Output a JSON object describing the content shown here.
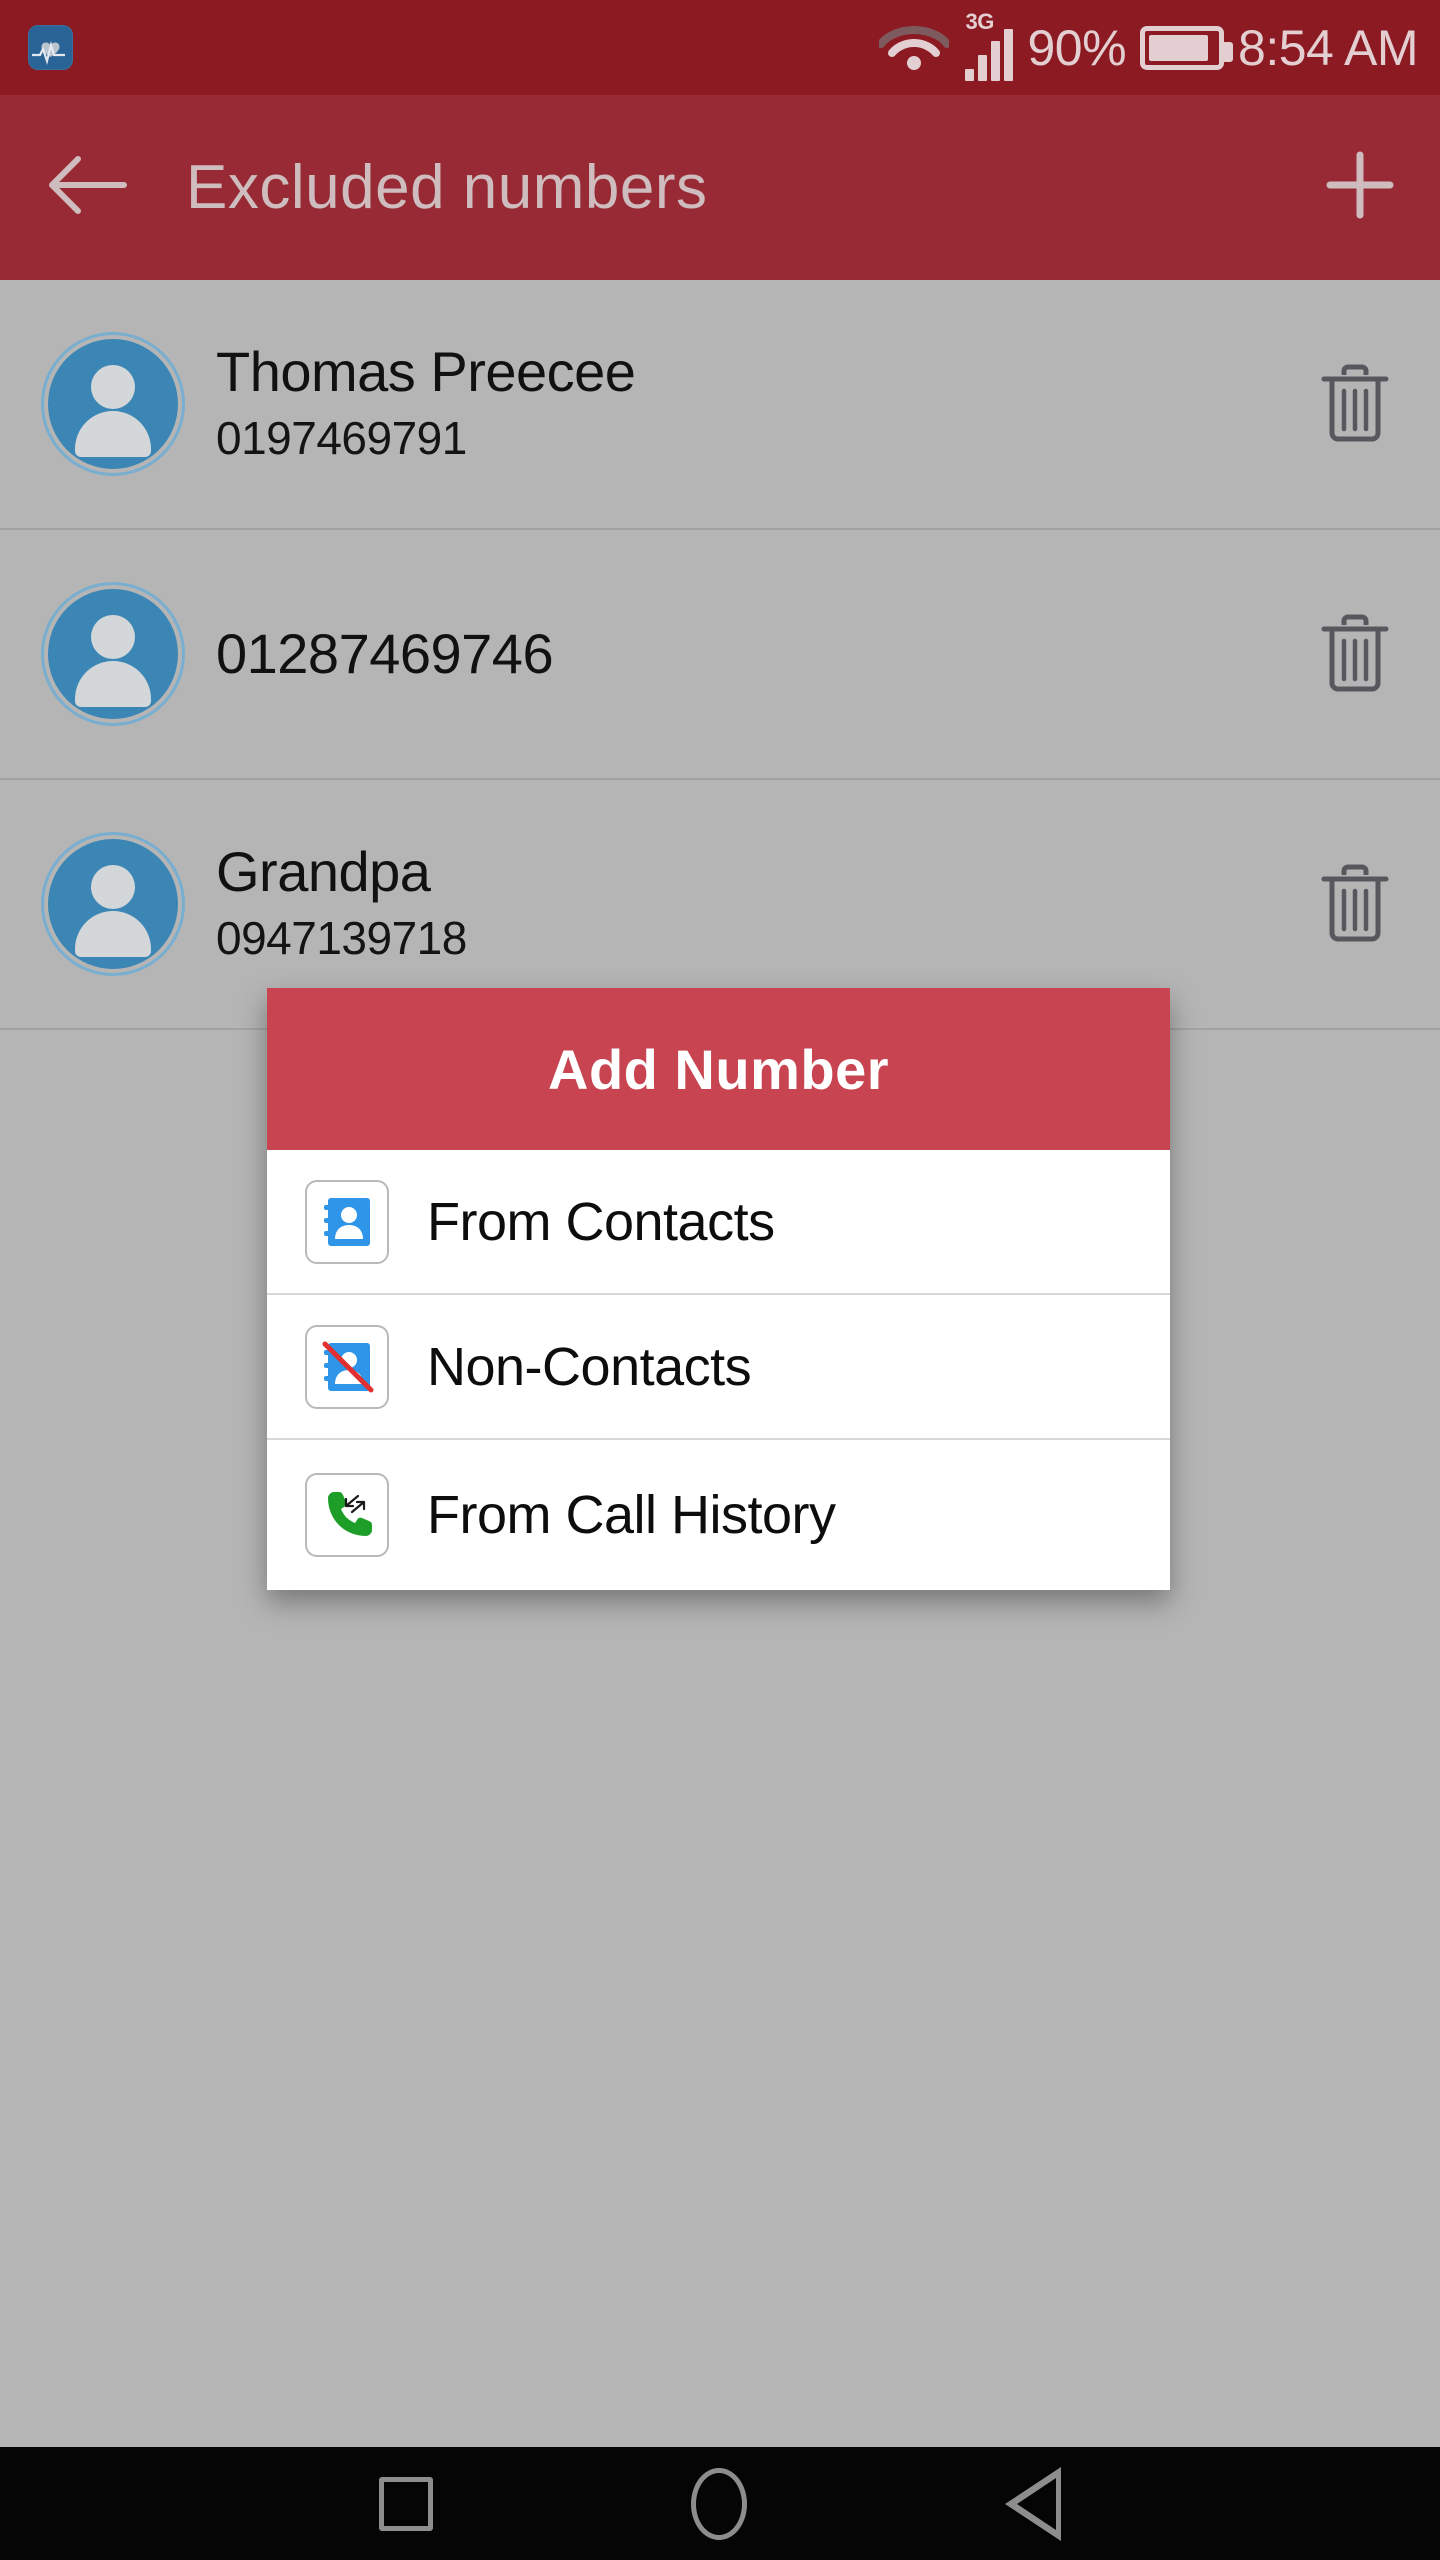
{
  "status_bar": {
    "app_icon": "heart-rate-app-icon",
    "wifi_icon": "wifi-icon",
    "network_label": "3G",
    "signal_icon": "signal-bars-icon",
    "battery_percent": "90%",
    "battery_icon": "battery-icon",
    "battery_level": 90,
    "time": "8:54 AM"
  },
  "app_bar": {
    "back_icon": "back-arrow-icon",
    "title": "Excluded numbers",
    "add_icon": "plus-icon"
  },
  "list": {
    "rows": [
      {
        "avatar_icon": "contact-avatar-icon",
        "name": "Thomas Preecee",
        "number": "0197469791",
        "delete_icon": "trash-icon"
      },
      {
        "avatar_icon": "contact-avatar-icon",
        "name": "",
        "number": "01287469746",
        "delete_icon": "trash-icon"
      },
      {
        "avatar_icon": "contact-avatar-icon",
        "name": "Grandpa",
        "number": "0947139718",
        "delete_icon": "trash-icon"
      }
    ]
  },
  "dialog": {
    "title": "Add Number",
    "header_color": "#c74450",
    "items": [
      {
        "icon": "contacts-book-icon",
        "label": "From Contacts"
      },
      {
        "icon": "contacts-book-blocked-icon",
        "label": "Non-Contacts"
      },
      {
        "icon": "call-history-icon",
        "label": "From Call History"
      }
    ]
  },
  "nav_bar": {
    "recents_icon": "recents-square-icon",
    "home_icon": "home-circle-icon",
    "back_icon": "back-triangle-icon"
  },
  "colors": {
    "status_bar": "#8b1a22",
    "app_bar": "#972a35",
    "dialog_accent": "#c74450",
    "page_background": "#b5b5b5",
    "avatar_blue": "#3b86b5"
  }
}
